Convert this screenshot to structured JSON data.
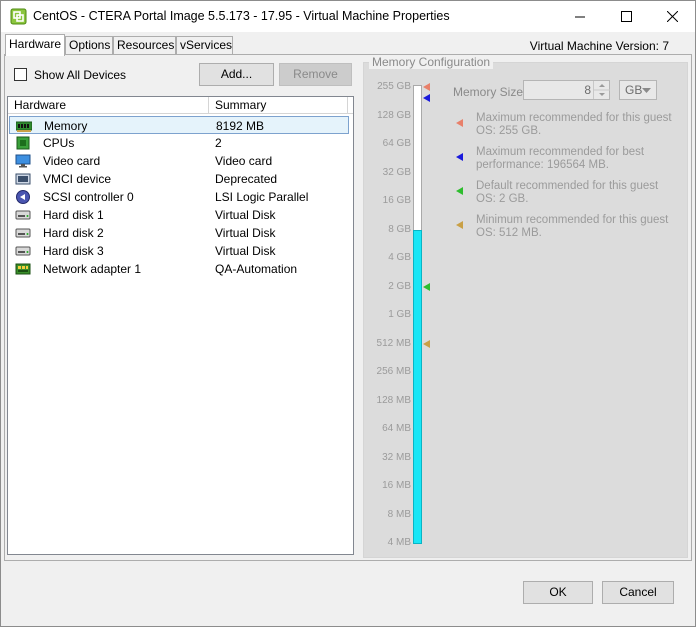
{
  "window": {
    "title": "CentOS - CTERA Portal Image 5.5.173 - 17.95 - Virtual Machine Properties"
  },
  "tabs": [
    {
      "label": "Hardware",
      "active": true
    },
    {
      "label": "Options"
    },
    {
      "label": "Resources"
    },
    {
      "label": "vServices"
    }
  ],
  "vm_version": "Virtual Machine Version: 7",
  "toolbar": {
    "show_all_label": "Show All Devices",
    "add_label": "Add...",
    "remove_label": "Remove"
  },
  "hardware_table": {
    "columns": [
      "Hardware",
      "Summary"
    ],
    "rows": [
      {
        "name": "Memory",
        "summary": "8192 MB",
        "icon": "memory-icon",
        "selected": true
      },
      {
        "name": "CPUs",
        "summary": "2",
        "icon": "cpu-icon"
      },
      {
        "name": "Video card",
        "summary": "Video card",
        "icon": "monitor-icon"
      },
      {
        "name": "VMCI device",
        "summary": "Deprecated",
        "icon": "vmci-icon"
      },
      {
        "name": "SCSI controller 0",
        "summary": "LSI Logic Parallel",
        "icon": "scsi-icon"
      },
      {
        "name": "Hard disk 1",
        "summary": "Virtual Disk",
        "icon": "hard-disk-icon"
      },
      {
        "name": "Hard disk 2",
        "summary": "Virtual Disk",
        "icon": "hard-disk-icon"
      },
      {
        "name": "Hard disk 3",
        "summary": "Virtual Disk",
        "icon": "hard-disk-icon"
      },
      {
        "name": "Network adapter 1",
        "summary": "QA-Automation",
        "icon": "network-icon"
      }
    ]
  },
  "memory": {
    "group_label": "Memory Configuration",
    "size_label": "Memory Size:",
    "size_value": "8",
    "unit": "GB",
    "scale_labels": [
      "255 GB",
      "128 GB",
      "64 GB",
      "32 GB",
      "16 GB",
      "8 GB",
      "4 GB",
      "2 GB",
      "1 GB",
      "512 MB",
      "256 MB",
      "128 MB",
      "64 MB",
      "32 MB",
      "16 MB",
      "8 MB",
      "4 MB"
    ],
    "filled_from_label_index": 5,
    "legend": [
      {
        "text": "Maximum recommended for this guest OS: 255 GB.",
        "color": "#e8806a",
        "marker_label_index": 0
      },
      {
        "text": "Maximum recommended for best performance: 196564 MB.",
        "color": "#1a1adc",
        "marker_label_index": 0.4
      },
      {
        "text": "Default recommended for this guest OS: 2 GB.",
        "color": "#2ebd2e",
        "marker_label_index": 7
      },
      {
        "text": "Minimum recommended for this guest OS: 512 MB.",
        "color": "#c9a046",
        "marker_label_index": 9
      }
    ]
  },
  "dialog_buttons": {
    "ok_label": "OK",
    "cancel_label": "Cancel"
  }
}
